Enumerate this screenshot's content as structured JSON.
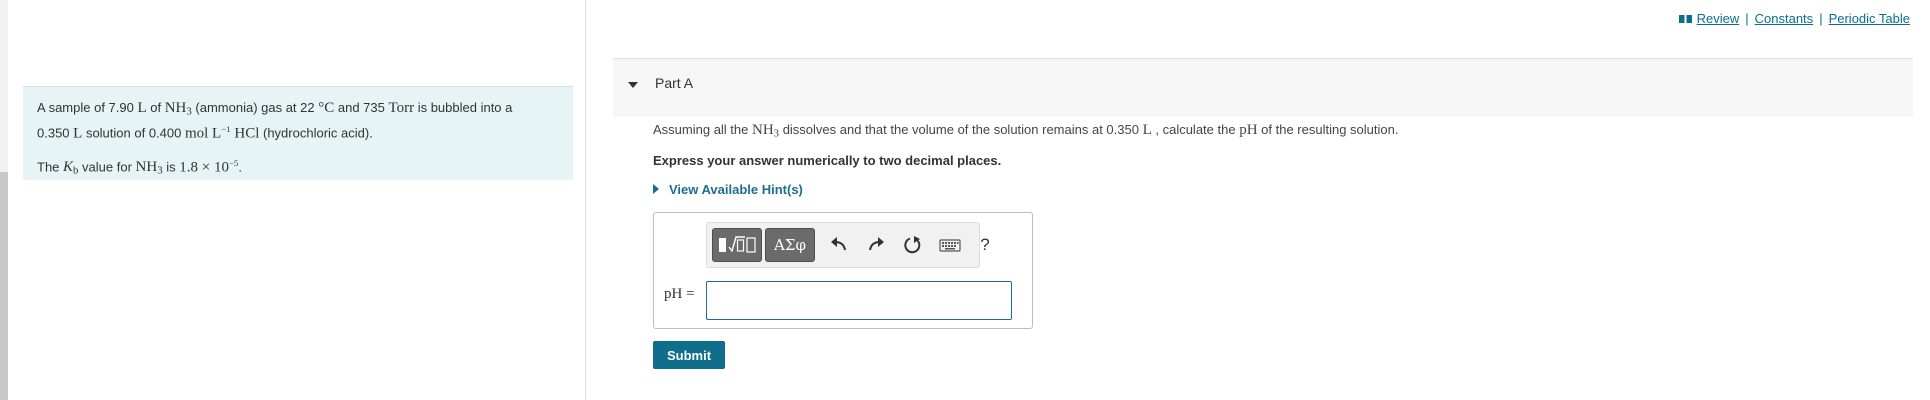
{
  "top_links": {
    "review": "Review",
    "constants": "Constants",
    "periodic_table": "Periodic Table",
    "separator": "|"
  },
  "intro": {
    "line1": {
      "t1": "A sample of 7.90 ",
      "u1": "L",
      "t2": " of ",
      "nh": "NH",
      "nh_sub": "3",
      "t3": " (ammonia) gas at 22 ",
      "deg": "°C",
      "t4": " and 735 ",
      "torr": "Torr",
      "t5": " is bubbled into a"
    },
    "line2": {
      "t1": "0.350 ",
      "u1": "L",
      "t2": " solution of 0.400 ",
      "mol": "mol L",
      "mol_sup": "−1",
      "hcl": " HCl",
      "t3": " (hydrochloric acid)."
    },
    "kb_line": {
      "t1": "The ",
      "k": "K",
      "k_sub": "b",
      "t2": " value for ",
      "nh": "NH",
      "nh_sub": "3",
      "t3": " is ",
      "val": "1.8 × 10",
      "exp": "−5",
      "t4": "."
    }
  },
  "part": {
    "title": "Part A"
  },
  "question": {
    "t1": "Assuming all the ",
    "nh": "NH",
    "nh_sub": "3",
    "t2": " dissolves and that the volume of the solution remains at 0.350 ",
    "unit": "L",
    "t3": " , calculate the ",
    "ph": "pH",
    "t4": " of the resulting solution."
  },
  "instruction": "Express your answer numerically to two decimal places.",
  "hint_label": "View Available Hint(s)",
  "toolbar": {
    "greek_label": "ΑΣφ",
    "help_label": "?"
  },
  "answer": {
    "label": "pH =",
    "value": ""
  },
  "submit_label": "Submit",
  "colors": {
    "accent": "#0f6e8c",
    "intro_bg": "#e6f4f5",
    "link": "#0b6e8f"
  }
}
